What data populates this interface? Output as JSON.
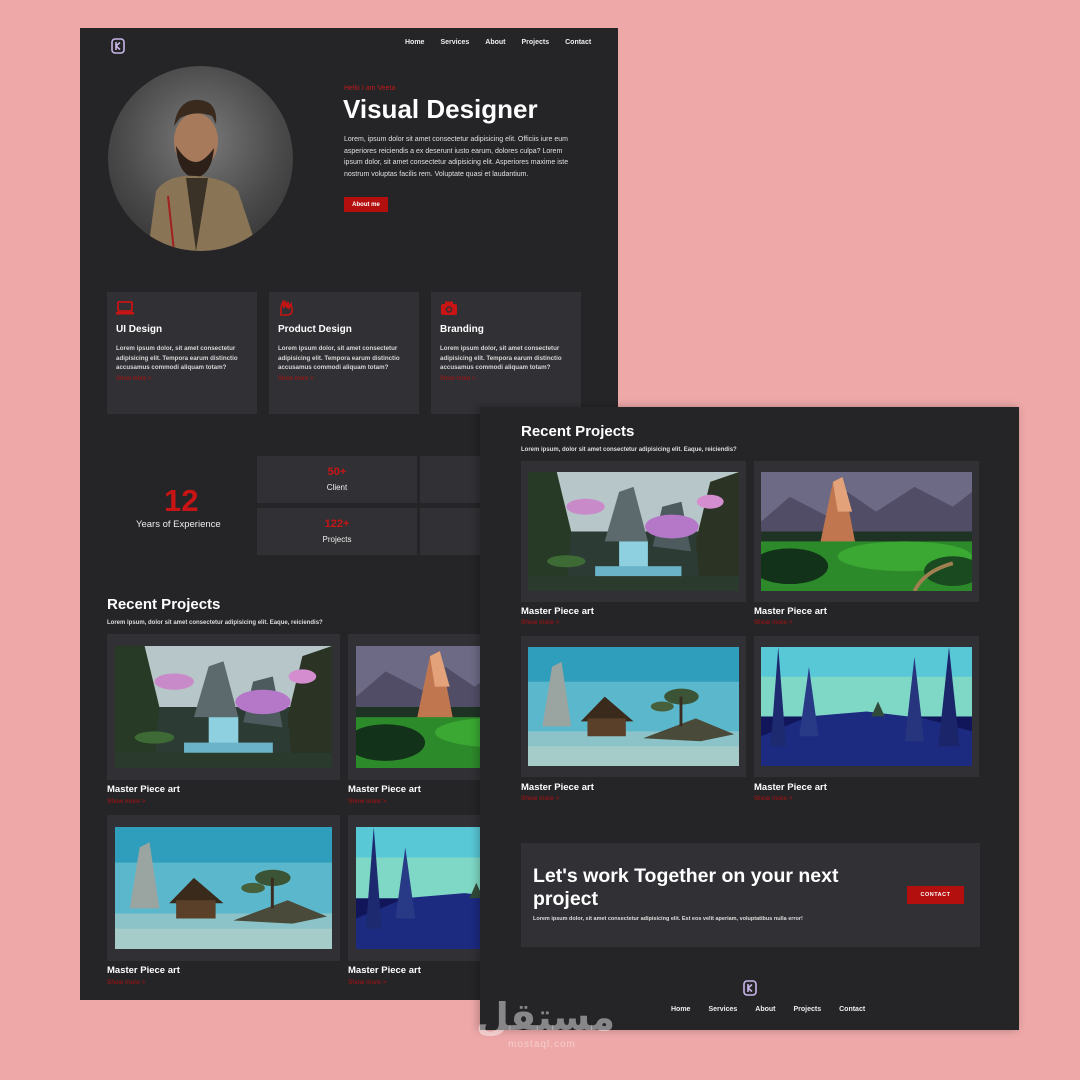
{
  "nav": {
    "items": [
      "Home",
      "Services",
      "About",
      "Projects",
      "Contact"
    ]
  },
  "hero": {
    "greeting": "Hello I am Veeta",
    "title": "Visual Designer",
    "text": "Lorem, ipsum dolor sit amet consectetur adipisicing elit. Officiis iure eum asperiores reiciendis a ex deserunt iusto earum, dolores culpa? Lorem ipsum dolor, sit amet consectetur adipisicing elit. Asperiores maxime iste nostrum voluptas facilis rem. Voluptate quasi et laudantium.",
    "button": "About me"
  },
  "services": [
    {
      "title": "UI Design",
      "text": "Lorem ipsum dolor, sit amet consectetur adipisicing elit. Tempora earum distinctio accusamus commodi aliquam totam?",
      "link": "Show more >",
      "icon": "laptop-icon"
    },
    {
      "title": "Product Design",
      "text": "Lorem ipsum dolor, sit amet consectetur adipisicing elit. Tempora earum distinctio accusamus commodi aliquam totam?",
      "link": "Show more >",
      "icon": "hand-icon"
    },
    {
      "title": "Branding",
      "text": "Lorem ipsum dolor, sit amet consectetur adipisicing elit. Tempora earum distinctio accusamus commodi aliquam totam?",
      "link": "Show more >",
      "icon": "camera-icon"
    }
  ],
  "stats": {
    "experience_number": "12",
    "experience_label": "Years of Experience",
    "items": [
      {
        "number": "50+",
        "label": "Client"
      },
      {
        "number": "122+",
        "label": "Projects"
      }
    ]
  },
  "projects": {
    "title": "Recent Projects",
    "subtitle": "Lorem ipsum, dolor sit amet consectetur adipisicing elit. Eaque, reiciendis?",
    "items": [
      {
        "title": "Master Piece art",
        "link": "Show more >"
      },
      {
        "title": "Master Piece art",
        "link": "Show more >"
      },
      {
        "title": "Master Piece art",
        "link": "Show more >"
      },
      {
        "title": "Master Piece art",
        "link": "Show more >"
      }
    ]
  },
  "cta": {
    "title": "Let's work Together on your next project",
    "text": "Lorem ipsum dolor, sit amet consectetur adipisicing elit. Est eos velit aperiam, voluptatibus nulla error!",
    "button": "CONTACT"
  },
  "footer": {
    "nav": [
      "Home",
      "Services",
      "About",
      "Projects",
      "Contact"
    ]
  },
  "watermark": {
    "text": "مستقل",
    "domain": "mostaql.com"
  },
  "colors": {
    "background": "#eea8a8",
    "panel": "#252528",
    "card": "#313135",
    "accent": "#c81414"
  }
}
